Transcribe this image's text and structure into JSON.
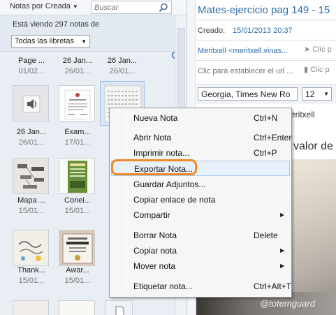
{
  "list": {
    "sort_label": "Notas por Creada",
    "search_placeholder": "Buscar",
    "count_text": "Está viendo 297 notas de",
    "notebook_select": "Todas las libretas"
  },
  "notes": [
    {
      "title": "Page ...",
      "date": "01/02..."
    },
    {
      "title": "26 Jan...",
      "date": "26/01..."
    },
    {
      "title": "26 Jan...",
      "date": "26/01..."
    },
    {
      "title": "26 Jan...",
      "date": "26/01..."
    },
    {
      "title": "Exam...",
      "date": "17/01..."
    },
    {
      "title": "Mapa ...",
      "date": "15/01..."
    },
    {
      "title": "Conei...",
      "date": "15/01..."
    },
    {
      "title": "Thank...",
      "date": "15/01..."
    },
    {
      "title": "Awar...",
      "date": "15/01..."
    }
  ],
  "editor": {
    "title": "Mates-ejercicio pag 149 - 15",
    "created_label": "Creado:",
    "created_value": "15/01/2013 20:37",
    "author": "Meritxell <meritxell.vinas...",
    "author_action": "Clic p",
    "url_hint": "Clic para establecer el url ...",
    "url_action": "Clic p",
    "font": "Georgia, Times New Ro",
    "size": "12",
    "body_text_1": "n.Meritxell",
    "body_text_2": "valor de"
  },
  "context_menu": {
    "items": [
      {
        "label": "Nueva Nota",
        "shortcut": "Ctrl+N"
      },
      {
        "label": "Abrir Nota",
        "shortcut": "Ctrl+Enter"
      },
      {
        "label": "Imprimir nota...",
        "shortcut": "Ctrl+P"
      },
      {
        "label": "Exportar Nota...",
        "shortcut": ""
      },
      {
        "label": "Guardar Adjuntos...",
        "shortcut": ""
      },
      {
        "label": "Copiar enlace de nota",
        "shortcut": ""
      },
      {
        "label": "Compartir",
        "shortcut": ""
      },
      {
        "label": "Borrar Nota",
        "shortcut": "Delete"
      },
      {
        "label": "Copiar nota",
        "shortcut": ""
      },
      {
        "label": "Mover nota",
        "shortcut": ""
      },
      {
        "label": "Etiquetar nota...",
        "shortcut": "Ctrl+Alt+T"
      }
    ],
    "highlight_color": "#f08a24"
  },
  "watermark": "@totemguard",
  "colors": {
    "accent_blue": "#2f6fad",
    "highlight": "#f08a24"
  }
}
